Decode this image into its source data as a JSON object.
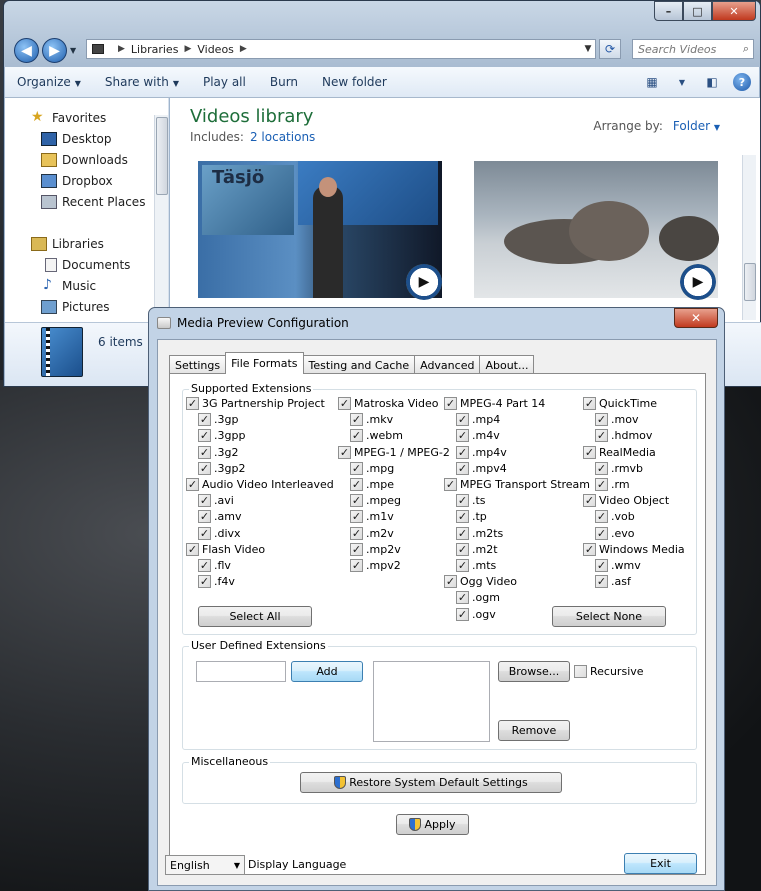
{
  "explorer": {
    "address": [
      "Libraries",
      "Videos"
    ],
    "search_placeholder": "Search Videos",
    "toolbar": {
      "organize": "Organize",
      "share": "Share with",
      "play": "Play all",
      "burn": "Burn",
      "new_folder": "New folder"
    },
    "nav": {
      "favorites": "Favorites",
      "desktop": "Desktop",
      "downloads": "Downloads",
      "dropbox": "Dropbox",
      "recent": "Recent Places",
      "libraries": "Libraries",
      "documents": "Documents",
      "music": "Music",
      "pictures": "Pictures"
    },
    "library": {
      "title": "Videos library",
      "includes_label": "Includes:",
      "locations": "2 locations",
      "arrange_label": "Arrange by:",
      "arrange_value": "Folder"
    },
    "thumb1_text": "Täsjö",
    "details": {
      "count": "6 items"
    }
  },
  "dialog": {
    "title": "Media Preview Configuration",
    "close": "✕",
    "tabs": [
      "Settings",
      "File Formats",
      "Testing and Cache",
      "Advanced",
      "About..."
    ],
    "active_tab": "File Formats",
    "supported_label": "Supported Extensions",
    "columns": [
      [
        {
          "label": "3G Partnership Project",
          "checked": true,
          "indent": false
        },
        {
          "label": ".3gp",
          "checked": true,
          "indent": true
        },
        {
          "label": ".3gpp",
          "checked": true,
          "indent": true
        },
        {
          "label": ".3g2",
          "checked": true,
          "indent": true
        },
        {
          "label": ".3gp2",
          "checked": true,
          "indent": true
        },
        {
          "label": "Audio Video Interleaved",
          "checked": true,
          "indent": false
        },
        {
          "label": ".avi",
          "checked": true,
          "indent": true
        },
        {
          "label": ".amv",
          "checked": true,
          "indent": true
        },
        {
          "label": ".divx",
          "checked": true,
          "indent": true
        },
        {
          "label": "Flash Video",
          "checked": true,
          "indent": false
        },
        {
          "label": ".flv",
          "checked": true,
          "indent": true
        },
        {
          "label": ".f4v",
          "checked": true,
          "indent": true
        }
      ],
      [
        {
          "label": "Matroska Video",
          "checked": true,
          "indent": false
        },
        {
          "label": ".mkv",
          "checked": true,
          "indent": true
        },
        {
          "label": ".webm",
          "checked": true,
          "indent": true
        },
        {
          "label": "MPEG-1 / MPEG-2",
          "checked": true,
          "indent": false
        },
        {
          "label": ".mpg",
          "checked": true,
          "indent": true
        },
        {
          "label": ".mpe",
          "checked": true,
          "indent": true
        },
        {
          "label": ".mpeg",
          "checked": true,
          "indent": true
        },
        {
          "label": ".m1v",
          "checked": true,
          "indent": true
        },
        {
          "label": ".m2v",
          "checked": true,
          "indent": true
        },
        {
          "label": ".mp2v",
          "checked": true,
          "indent": true
        },
        {
          "label": ".mpv2",
          "checked": true,
          "indent": true
        }
      ],
      [
        {
          "label": "MPEG-4 Part 14",
          "checked": true,
          "indent": false
        },
        {
          "label": ".mp4",
          "checked": true,
          "indent": true
        },
        {
          "label": ".m4v",
          "checked": true,
          "indent": true
        },
        {
          "label": ".mp4v",
          "checked": true,
          "indent": true
        },
        {
          "label": ".mpv4",
          "checked": true,
          "indent": true
        },
        {
          "label": "MPEG Transport Stream",
          "checked": true,
          "indent": false
        },
        {
          "label": ".ts",
          "checked": true,
          "indent": true
        },
        {
          "label": ".tp",
          "checked": true,
          "indent": true
        },
        {
          "label": ".m2ts",
          "checked": true,
          "indent": true
        },
        {
          "label": ".m2t",
          "checked": true,
          "indent": true
        },
        {
          "label": ".mts",
          "checked": true,
          "indent": true
        },
        {
          "label": "Ogg Video",
          "checked": true,
          "indent": false
        },
        {
          "label": ".ogm",
          "checked": true,
          "indent": true
        },
        {
          "label": ".ogv",
          "checked": true,
          "indent": true
        }
      ],
      [
        {
          "label": "QuickTime",
          "checked": true,
          "indent": false
        },
        {
          "label": ".mov",
          "checked": true,
          "indent": true
        },
        {
          "label": ".hdmov",
          "checked": true,
          "indent": true
        },
        {
          "label": "RealMedia",
          "checked": true,
          "indent": false
        },
        {
          "label": ".rmvb",
          "checked": true,
          "indent": true
        },
        {
          "label": ".rm",
          "checked": true,
          "indent": true
        },
        {
          "label": "Video Object",
          "checked": true,
          "indent": false
        },
        {
          "label": ".vob",
          "checked": true,
          "indent": true
        },
        {
          "label": ".evo",
          "checked": true,
          "indent": true
        },
        {
          "label": "Windows Media",
          "checked": true,
          "indent": false
        },
        {
          "label": ".wmv",
          "checked": true,
          "indent": true
        },
        {
          "label": ".asf",
          "checked": true,
          "indent": true
        }
      ]
    ],
    "select_all": "Select All",
    "select_none": "Select None",
    "user_defined_label": "User Defined Extensions",
    "user_ext_value": "",
    "add": "Add",
    "browse": "Browse...",
    "recursive": "Recursive",
    "recursive_checked": false,
    "remove": "Remove",
    "misc_label": "Miscellaneous",
    "restore": "Restore System Default Settings",
    "apply": "Apply",
    "language": "English",
    "language_label": "Display Language",
    "exit": "Exit"
  }
}
